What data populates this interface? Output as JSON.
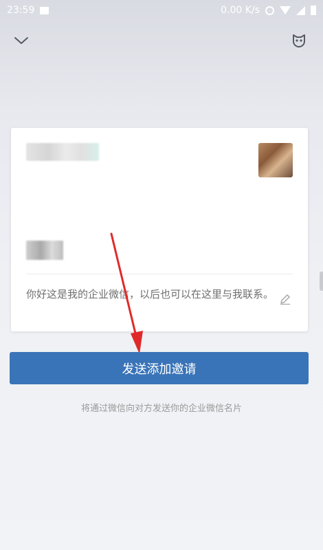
{
  "status_bar": {
    "time": "23:59",
    "network_speed": "0.00 K/s",
    "icons": [
      "image-icon",
      "alarm-icon",
      "wifi-icon",
      "signal-icon",
      "battery-icon"
    ]
  },
  "header": {
    "icons": [
      "chevron-down-icon",
      "mask-icon"
    ]
  },
  "card": {
    "greeting": "你好这是我的企业微信，以后也可以在这里与我联系。",
    "icons": [
      "pencil-icon"
    ]
  },
  "actions": {
    "send_label": "发送添加邀请",
    "hint": "将通过微信向对方发送你的企业微信名片"
  },
  "colors": {
    "accent": "#3a74b8",
    "annotation_arrow": "#e02a2a"
  }
}
